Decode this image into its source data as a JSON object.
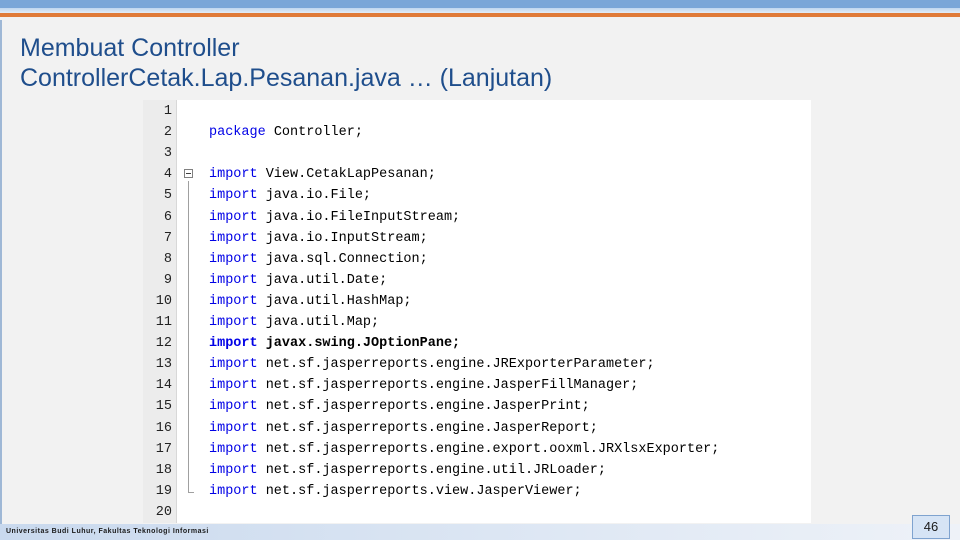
{
  "slide": {
    "title_line1": "Membuat Controller",
    "title_line2": "ControllerCetak.Lap.Pesanan.java … (Lanjutan)",
    "footer": "Universitas Budi Luhur, Fakultas Teknologi Informasi",
    "page_number": "46"
  },
  "code": {
    "lines": [
      {
        "num": "1",
        "keyword": "",
        "text": ""
      },
      {
        "num": "2",
        "keyword": "package",
        "text": " Controller;"
      },
      {
        "num": "3",
        "keyword": "",
        "text": ""
      },
      {
        "num": "4",
        "keyword": "import",
        "text": " View.CetakLapPesanan;"
      },
      {
        "num": "5",
        "keyword": "import",
        "text": " java.io.File;"
      },
      {
        "num": "6",
        "keyword": "import",
        "text": " java.io.FileInputStream;"
      },
      {
        "num": "7",
        "keyword": "import",
        "text": " java.io.InputStream;"
      },
      {
        "num": "8",
        "keyword": "import",
        "text": " java.sql.Connection;"
      },
      {
        "num": "9",
        "keyword": "import",
        "text": " java.util.Date;"
      },
      {
        "num": "10",
        "keyword": "import",
        "text": " java.util.HashMap;"
      },
      {
        "num": "11",
        "keyword": "import",
        "text": " java.util.Map;"
      },
      {
        "num": "12",
        "keyword": "import",
        "text": " javax.swing.JOptionPane;"
      },
      {
        "num": "13",
        "keyword": "import",
        "text": " net.sf.jasperreports.engine.JRExporterParameter;"
      },
      {
        "num": "14",
        "keyword": "import",
        "text": " net.sf.jasperreports.engine.JasperFillManager;"
      },
      {
        "num": "15",
        "keyword": "import",
        "text": " net.sf.jasperreports.engine.JasperPrint;"
      },
      {
        "num": "16",
        "keyword": "import",
        "text": " net.sf.jasperreports.engine.JasperReport;"
      },
      {
        "num": "17",
        "keyword": "import",
        "text": " net.sf.jasperreports.engine.export.ooxml.JRXlsxExporter;"
      },
      {
        "num": "18",
        "keyword": "import",
        "text": " net.sf.jasperreports.engine.util.JRLoader;"
      },
      {
        "num": "19",
        "keyword": "import",
        "text": " net.sf.jasperreports.view.JasperViewer;"
      },
      {
        "num": "20",
        "keyword": "",
        "text": ""
      }
    ]
  }
}
